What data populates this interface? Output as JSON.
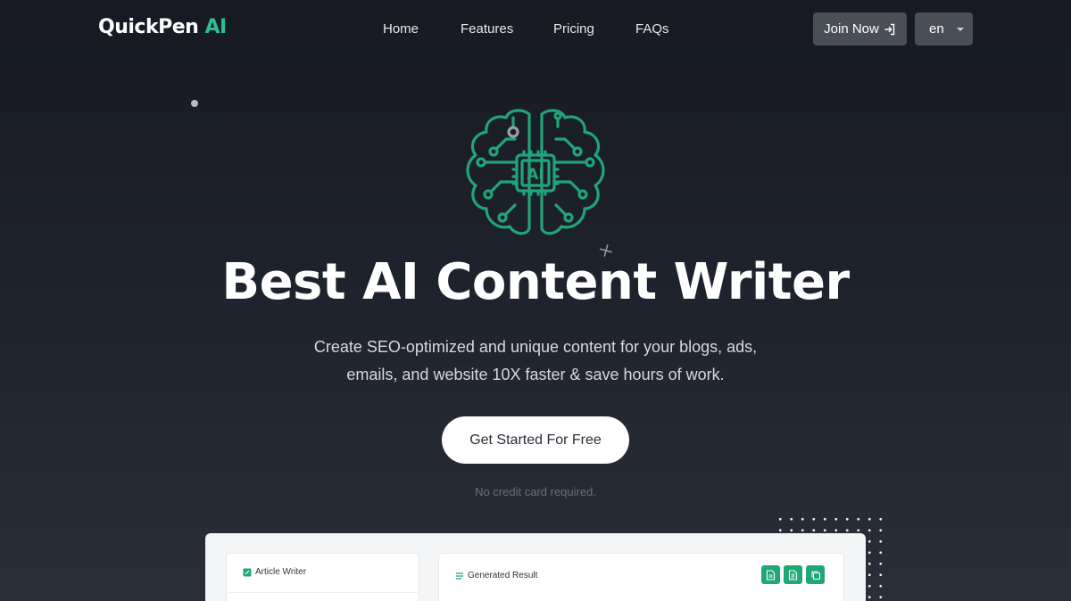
{
  "brand": {
    "name": "QuickPen",
    "accent": "AI"
  },
  "nav": {
    "items": [
      "Home",
      "Features",
      "Pricing",
      "FAQs"
    ],
    "join_label": "Join Now",
    "lang_label": "en"
  },
  "hero": {
    "chip_label": "AI",
    "title": "Best AI Content Writer",
    "subtitle_line1": "Create SEO-optimized and unique content for your blogs, ads,",
    "subtitle_line2": "emails, and website 10X faster & save hours of work.",
    "cta_label": "Get Started For Free",
    "note": "No credit card required."
  },
  "preview": {
    "left_card_title": "Article Writer",
    "right_card_title": "Generated Result",
    "action_icons": [
      "doc-icon",
      "file-text-icon",
      "copy-icon"
    ]
  },
  "colors": {
    "accent": "#2bbf8f",
    "button_gray": "#4a4e57",
    "action_green": "#1fa776"
  }
}
